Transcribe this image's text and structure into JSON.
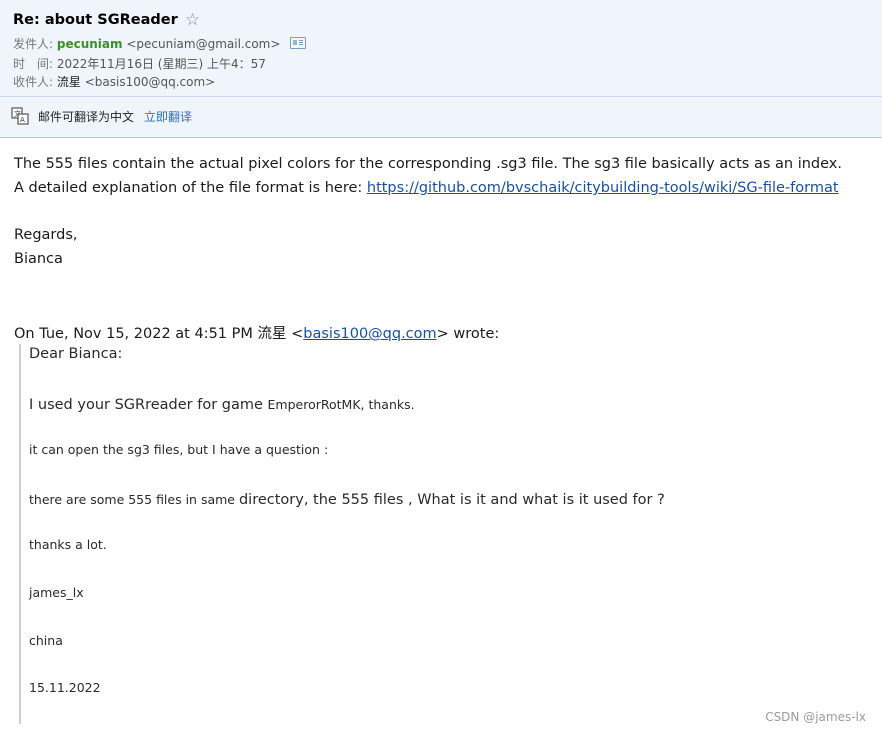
{
  "header": {
    "subject": "Re: about SGReader",
    "star_icon": "☆",
    "from_label": "发件人:",
    "from_name": "pecuniam",
    "from_email": "<pecuniam@gmail.com>",
    "time_label": "时　间:",
    "time_value": "2022年11月16日 (星期三) 上午4：57",
    "to_label": "收件人:",
    "to_name": "流星",
    "to_email": "<basis100@qq.com>"
  },
  "translate": {
    "text": "邮件可翻译为中文",
    "link": "立即翻译"
  },
  "body": {
    "line1": "The 555 files contain the actual pixel colors for the corresponding .sg3 file. The sg3 file basically acts as an index.",
    "line2_prefix": "A detailed explanation of the file format is here: ",
    "line2_link": "https://github.com/bvschaik/citybuilding-tools/wiki/SG-file-format",
    "regards": "Regards,",
    "signature": "Bianca",
    "quote_intro_prefix": "On Tue, Nov 15, 2022 at 4:51 PM 流星 <",
    "quote_intro_email": "basis100@qq.com",
    "quote_intro_suffix": "> wrote:"
  },
  "quote": {
    "greeting": "Dear Bianca:",
    "line1_a": "I used your SGRreader for  game ",
    "line1_b": "EmperorRotMK, thanks.",
    "line2": "it can open the sg3 files, but I have a question :",
    "line3_a": "there are some 555 files in same ",
    "line3_b": "directory, the 555 files , What is it and what is it used for ?",
    "line4": "thanks a lot.",
    "line5": "james_lx",
    "line6": "china",
    "line7": "15.11.2022"
  },
  "watermark": "CSDN @james-lx",
  "colors": {
    "header_bg": "#eff5fb",
    "sender_green": "#3a8f2d",
    "link_blue": "#1a4fa0"
  }
}
